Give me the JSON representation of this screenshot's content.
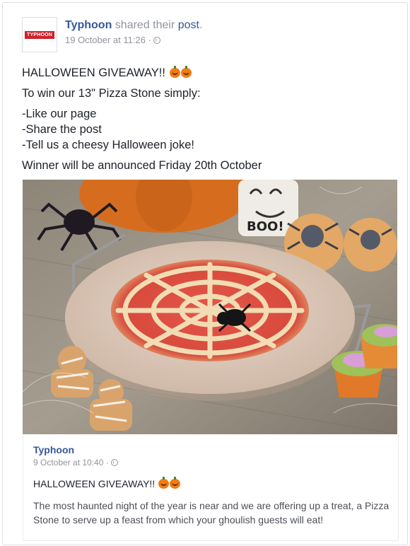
{
  "post": {
    "author": "Typhoon",
    "shared_text": " shared their ",
    "post_link": "post",
    "period": ".",
    "logo_text": "TYPHOON",
    "timestamp": "19 October at 11:26 ·",
    "privacy_icon": "globe-icon",
    "headline": "HALLOWEEN GIVEAWAY!!",
    "intro": "To win our 13\" Pizza Stone simply:",
    "steps": [
      "-Like our page",
      "-Share the post",
      "-Tell us a cheesy Halloween joke!"
    ],
    "winner": "Winner will be announced Friday 20th October",
    "boo_text": "BOO!"
  },
  "shared_post": {
    "author": "Typhoon",
    "timestamp": "9 October at 10:40 ·",
    "privacy_icon": "globe-icon",
    "title": "HALLOWEEN GIVEAWAY!!",
    "body": "The most haunted night of the year is near and we are offering up a treat, a Pizza Stone to serve up a feast from which your ghoulish guests will eat!"
  },
  "colors": {
    "link": "#365899",
    "muted": "#90949c",
    "brand": "#d0202a",
    "pumpkin": "#f07c14"
  }
}
